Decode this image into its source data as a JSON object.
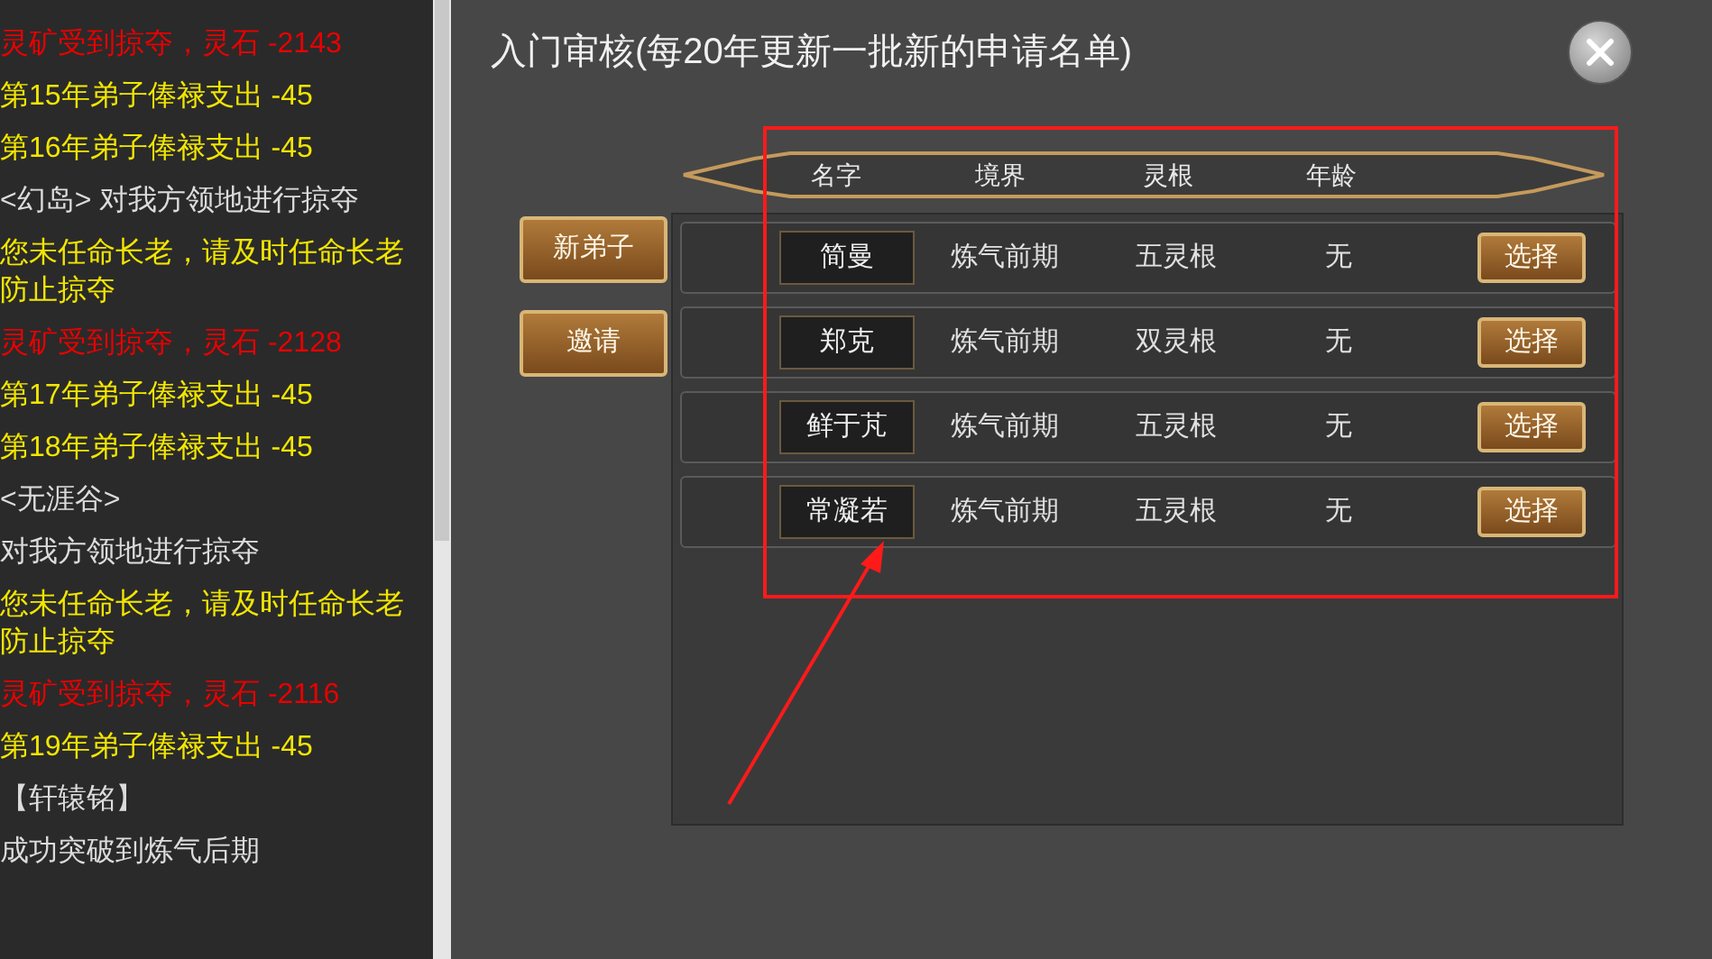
{
  "log": [
    {
      "text": "灵矿受到掠夺，灵石 -2143",
      "color": "#e80000"
    },
    {
      "text": "第15年弟子俸禄支出 -45",
      "color": "#f2e600"
    },
    {
      "text": "第16年弟子俸禄支出 -45",
      "color": "#f2e600"
    },
    {
      "text": "<幻岛> 对我方领地进行掠夺",
      "color": "#dcdcdc"
    },
    {
      "text": "您未任命长老，请及时任命长老防止掠夺",
      "color": "#f2e600"
    },
    {
      "text": "灵矿受到掠夺，灵石 -2128",
      "color": "#e80000"
    },
    {
      "text": "第17年弟子俸禄支出 -45",
      "color": "#f2e600"
    },
    {
      "text": "第18年弟子俸禄支出 -45",
      "color": "#f2e600"
    },
    {
      "text": "<无涯谷>",
      "color": "#dcdcdc"
    },
    {
      "text": "对我方领地进行掠夺",
      "color": "#dcdcdc"
    },
    {
      "text": "您未任命长老，请及时任命长老防止掠夺",
      "color": "#f2e600"
    },
    {
      "text": "灵矿受到掠夺，灵石 -2116",
      "color": "#e80000"
    },
    {
      "text": "第19年弟子俸禄支出 -45",
      "color": "#f2e600"
    },
    {
      "text": "【轩辕铭】",
      "color": "#dcdcdc"
    },
    {
      "text": "成功突破到炼气后期",
      "color": "#dcdcdc"
    }
  ],
  "dialog": {
    "title": "入门审核(每20年更新一批新的申请名单)",
    "side_buttons": [
      {
        "label": "新弟子"
      },
      {
        "label": "邀请"
      }
    ],
    "columns": [
      "名字",
      "境界",
      "灵根",
      "年龄"
    ],
    "rows": [
      {
        "name": "简曼",
        "realm": "炼气前期",
        "root": "五灵根",
        "age": "无",
        "action": "选择"
      },
      {
        "name": "郑克",
        "realm": "炼气前期",
        "root": "双灵根",
        "age": "无",
        "action": "选择"
      },
      {
        "name": "鲜于芃",
        "realm": "炼气前期",
        "root": "五灵根",
        "age": "无",
        "action": "选择"
      },
      {
        "name": "常凝若",
        "realm": "炼气前期",
        "root": "五灵根",
        "age": "无",
        "action": "选择"
      }
    ]
  }
}
